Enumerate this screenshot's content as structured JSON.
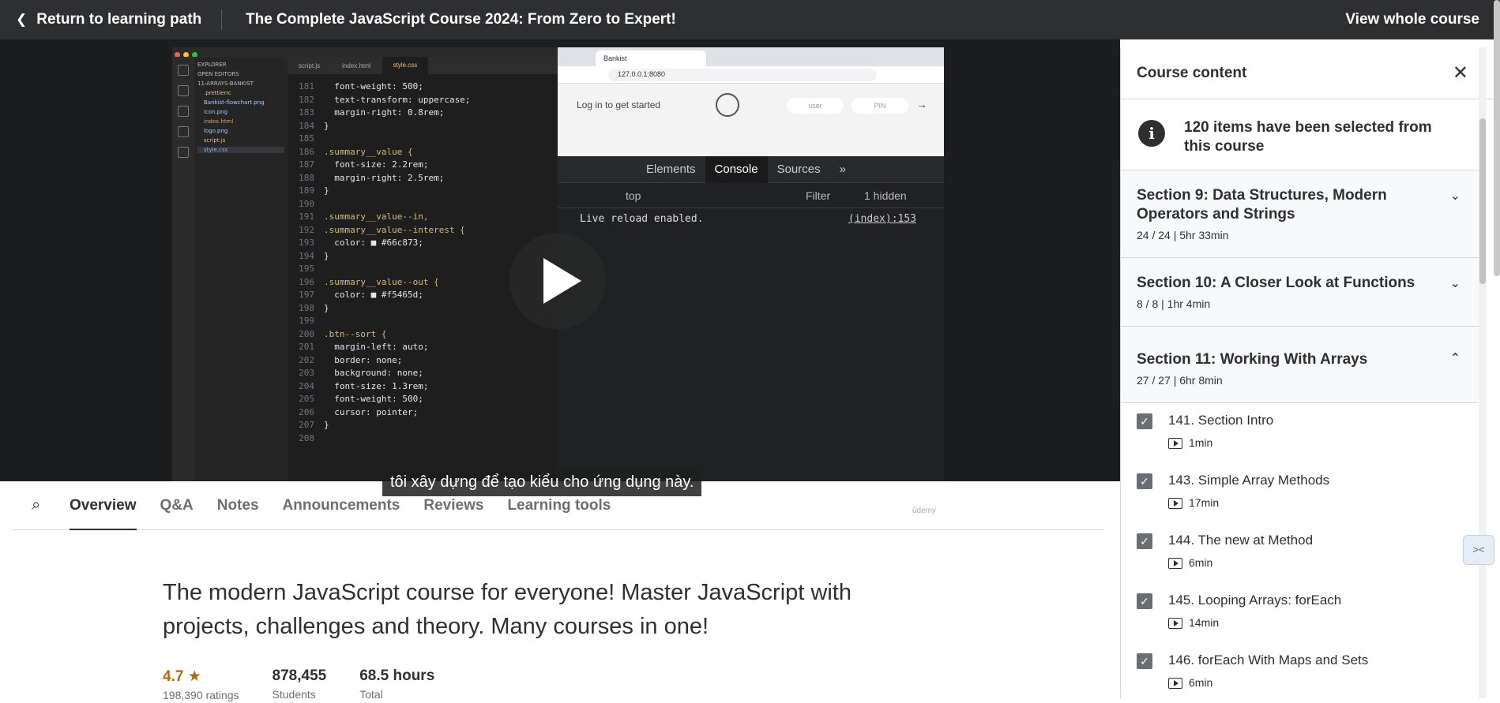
{
  "topbar": {
    "back_label": "Return to learning path",
    "course_title": "The Complete JavaScript Course 2024: From Zero to Expert!",
    "view_whole": "View whole course"
  },
  "video": {
    "caption": "tôi xây dựng để tạo kiểu cho ứng dụng này.",
    "watermark": "ûdemy",
    "vscode": {
      "explorer_items": [
        "EXPLORER",
        "OPEN EDITORS",
        "11-ARRAYS-BANKIST",
        ".prettierrc",
        "Bankist-flowchart.png",
        "icon.png",
        "index.html",
        "logo.png",
        "script.js",
        "style.css"
      ],
      "tabs": [
        "script.js",
        "index.html",
        "style.css"
      ],
      "code_lines": [
        {
          "n": "181",
          "t": "  font-weight: 500;"
        },
        {
          "n": "182",
          "t": "  text-transform: uppercase;"
        },
        {
          "n": "183",
          "t": "  margin-right: 0.8rem;"
        },
        {
          "n": "184",
          "t": "}"
        },
        {
          "n": "185",
          "t": ""
        },
        {
          "n": "186",
          "t": ".summary__value {"
        },
        {
          "n": "187",
          "t": "  font-size: 2.2rem;"
        },
        {
          "n": "188",
          "t": "  margin-right: 2.5rem;"
        },
        {
          "n": "189",
          "t": "}"
        },
        {
          "n": "190",
          "t": ""
        },
        {
          "n": "191",
          "t": ".summary__value--in,"
        },
        {
          "n": "192",
          "t": ".summary__value--interest {"
        },
        {
          "n": "193",
          "t": "  color: ■ #66c873;"
        },
        {
          "n": "194",
          "t": "}"
        },
        {
          "n": "195",
          "t": ""
        },
        {
          "n": "196",
          "t": ".summary__value--out {"
        },
        {
          "n": "197",
          "t": "  color: ■ #f5465d;"
        },
        {
          "n": "198",
          "t": "}"
        },
        {
          "n": "199",
          "t": ""
        },
        {
          "n": "200",
          "t": ".btn--sort {"
        },
        {
          "n": "201",
          "t": "  margin-left: auto;"
        },
        {
          "n": "202",
          "t": "  border: none;"
        },
        {
          "n": "203",
          "t": "  background: none;"
        },
        {
          "n": "204",
          "t": "  font-size: 1.3rem;"
        },
        {
          "n": "205",
          "t": "  font-weight: 500;"
        },
        {
          "n": "206",
          "t": "  cursor: pointer;"
        },
        {
          "n": "207",
          "t": "}"
        },
        {
          "n": "208",
          "t": ""
        }
      ]
    },
    "browser": {
      "tab_title": "Bankist",
      "url": "127.0.0.1:8080",
      "login_text": "Log in to get started",
      "user_placeholder": "user",
      "pin_placeholder": "PIN",
      "arrow": "→",
      "devtools_tabs": [
        "Elements",
        "Console",
        "Sources",
        "»"
      ],
      "context": "top",
      "filter": "Filter",
      "hidden": "1 hidden",
      "log_text": "Live reload enabled.",
      "log_src": "(index):153"
    }
  },
  "tabs": [
    {
      "label": "Overview",
      "active": true
    },
    {
      "label": "Q&A"
    },
    {
      "label": "Notes"
    },
    {
      "label": "Announcements"
    },
    {
      "label": "Reviews"
    },
    {
      "label": "Learning tools"
    }
  ],
  "overview": {
    "description": "The modern JavaScript course for everyone! Master JavaScript with projects, challenges and theory. Many courses in one!",
    "rating": "4.7",
    "rating_label": "198,390 ratings",
    "students": "878,455",
    "students_label": "Students",
    "hours": "68.5 hours",
    "hours_label": "Total"
  },
  "sidebar": {
    "title": "Course content",
    "notice": "120 items have been selected from this course",
    "sections": [
      {
        "title": "Section 9: Data Structures, Modern Operators and Strings",
        "meta": "24 / 24 | 5hr 33min",
        "expanded": false
      },
      {
        "title": "Section 10: A Closer Look at Functions",
        "meta": "8 / 8 | 1hr 4min",
        "expanded": false
      },
      {
        "title": "Section 11: Working With Arrays",
        "meta": "27 / 27 | 6hr 8min",
        "expanded": true
      }
    ],
    "lectures": [
      {
        "title": "141. Section Intro",
        "duration": "1min"
      },
      {
        "title": "143. Simple Array Methods",
        "duration": "17min"
      },
      {
        "title": "144. The new at Method",
        "duration": "6min"
      },
      {
        "title": "145. Looping Arrays: forEach",
        "duration": "14min"
      },
      {
        "title": "146. forEach With Maps and Sets",
        "duration": "6min"
      }
    ]
  },
  "colors": {
    "topbar": "#2d2f31",
    "rating": "#b4690e",
    "checkbox": "#6a6f73"
  }
}
